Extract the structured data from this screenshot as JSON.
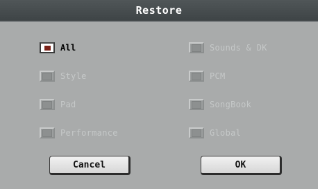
{
  "dialog": {
    "title": "Restore"
  },
  "options": [
    {
      "label": "All",
      "checked": true,
      "enabled": true
    },
    {
      "label": "Style",
      "checked": false,
      "enabled": false
    },
    {
      "label": "Pad",
      "checked": false,
      "enabled": false
    },
    {
      "label": "Performance",
      "checked": false,
      "enabled": false
    },
    {
      "label": "Sounds & DK",
      "checked": false,
      "enabled": false
    },
    {
      "label": "PCM",
      "checked": false,
      "enabled": false
    },
    {
      "label": "SongBook",
      "checked": false,
      "enabled": false
    },
    {
      "label": "Global",
      "checked": false,
      "enabled": false
    }
  ],
  "buttons": {
    "cancel_label": "Cancel",
    "ok_label": "OK"
  },
  "colors": {
    "panel_bg": "#a9abab",
    "title_bg": "#474d4f",
    "checked_mark": "#7b2219",
    "disabled_text": "#c5c8c8"
  }
}
